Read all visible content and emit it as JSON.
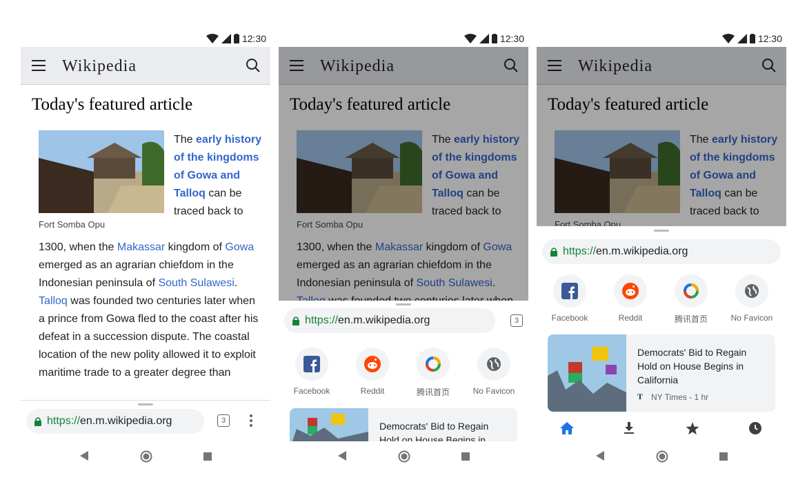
{
  "status": {
    "time": "12:30"
  },
  "wiki": {
    "logo": "Wikipedia",
    "heading": "Today's featured article",
    "caption": "Fort Somba Opu",
    "float_text": {
      "t1": "The ",
      "l1": "early history of the kingdoms of Gowa and Talloq",
      "t2": " can be traced back to"
    },
    "body": {
      "t1": "1300, when the ",
      "l1": "Makassar",
      "t2": " kingdom of ",
      "l2": "Gowa",
      "t3": " emerged as an agrarian chiefdom in the Indonesian peninsula of ",
      "l3": "South Sulawesi",
      "t4": ". ",
      "l4": "Talloq",
      "t5": " was founded two centuries later when a prince from Gowa fled to the coast after his defeat in a succession dispute. The coastal location of the new polity allowed it to exploit maritime trade to a greater degree than"
    }
  },
  "toolbar": {
    "url_scheme": "https://",
    "url_host": "en.m.wikipedia.org",
    "tab_count": "3"
  },
  "sites": [
    {
      "label": "Facebook",
      "icon": "facebook-icon",
      "color": "#3b5998"
    },
    {
      "label": "Reddit",
      "icon": "reddit-icon",
      "color": "#ff4500"
    },
    {
      "label": "腾讯首页",
      "icon": "tencent-icon",
      "color": "#2aa24a"
    },
    {
      "label": "No Favicon",
      "icon": "globe-icon",
      "color": "#5f6368"
    }
  ],
  "article_card": {
    "title": "Democrats' Bid to Regain Hold on House Begins in California",
    "source": "NY Times - 1 hr",
    "source_icon": "nyt-icon"
  },
  "bottom_nav": [
    "home-icon",
    "download-icon",
    "star-icon",
    "history-icon"
  ],
  "colors": {
    "link": "#3366cc",
    "secure": "#188038",
    "accent": "#1a73e8"
  }
}
